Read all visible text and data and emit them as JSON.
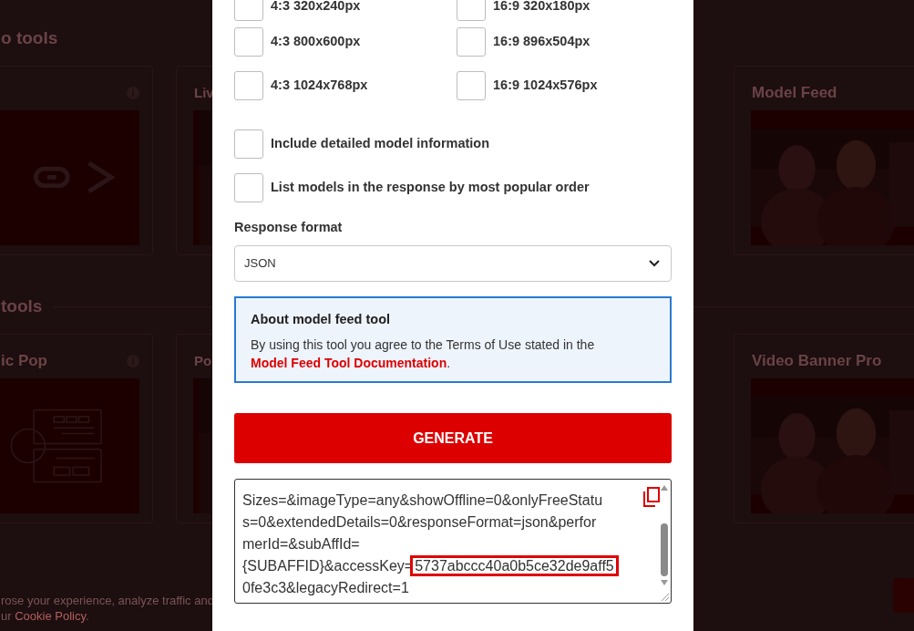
{
  "background": {
    "sections": [
      {
        "title": "o tools",
        "cards": [
          {
            "kind": "link-art",
            "info": true
          },
          {
            "title": "Liv",
            "kind": "picture"
          },
          {
            "title": "Model Feed",
            "kind": "picture"
          }
        ]
      },
      {
        "title": "tools",
        "cards": [
          {
            "title": "ic Pop",
            "kind": "diagram-art",
            "info": true
          },
          {
            "title": "Po",
            "kind": "picture"
          },
          {
            "title": "Video Banner Pro",
            "kind": "picture"
          }
        ]
      }
    ],
    "cookie_banner": {
      "line_1": "rose your experience, analyze traffic and",
      "line_2": {
        "before": "ur ",
        "link": "Cookie Policy",
        "after": "."
      }
    }
  },
  "modal": {
    "image_sizes": [
      {
        "label": "4:3 320x240px",
        "checked": false
      },
      {
        "label": "16:9 320x180px",
        "checked": false
      },
      {
        "label": "4:3 800x600px",
        "checked": false
      },
      {
        "label": "16:9 896x504px",
        "checked": false
      },
      {
        "label": "4:3 1024x768px",
        "checked": false
      },
      {
        "label": "16:9 1024x576px",
        "checked": false
      }
    ],
    "options": [
      {
        "label": "Include detailed model information",
        "checked": false
      },
      {
        "label": "List models in the response by most popular order",
        "checked": false
      }
    ],
    "response_format": {
      "label": "Response format",
      "value": "JSON"
    },
    "info": {
      "title": "About model feed tool",
      "text": "By using this tool you agree to the Terms of Use stated in the ",
      "link": "Model Feed Tool Documentation",
      "after": "."
    },
    "generate_button": "GENERATE",
    "output": {
      "lines": [
        {
          "text": "Sizes=&imageType=any&showOffline=0&onlyFreeStatu"
        },
        {
          "text": "s=0&extendedDetails=0&responseFormat=json&perfor"
        },
        {
          "text": "merId=&subAffId="
        },
        {
          "text": "{SUBAFFID}&accessKey=",
          "highlight": "5737abccc40a0b5ce32de9aff5"
        },
        {
          "text": "0fe3c3&legacyRedirect=1"
        }
      ]
    }
  }
}
